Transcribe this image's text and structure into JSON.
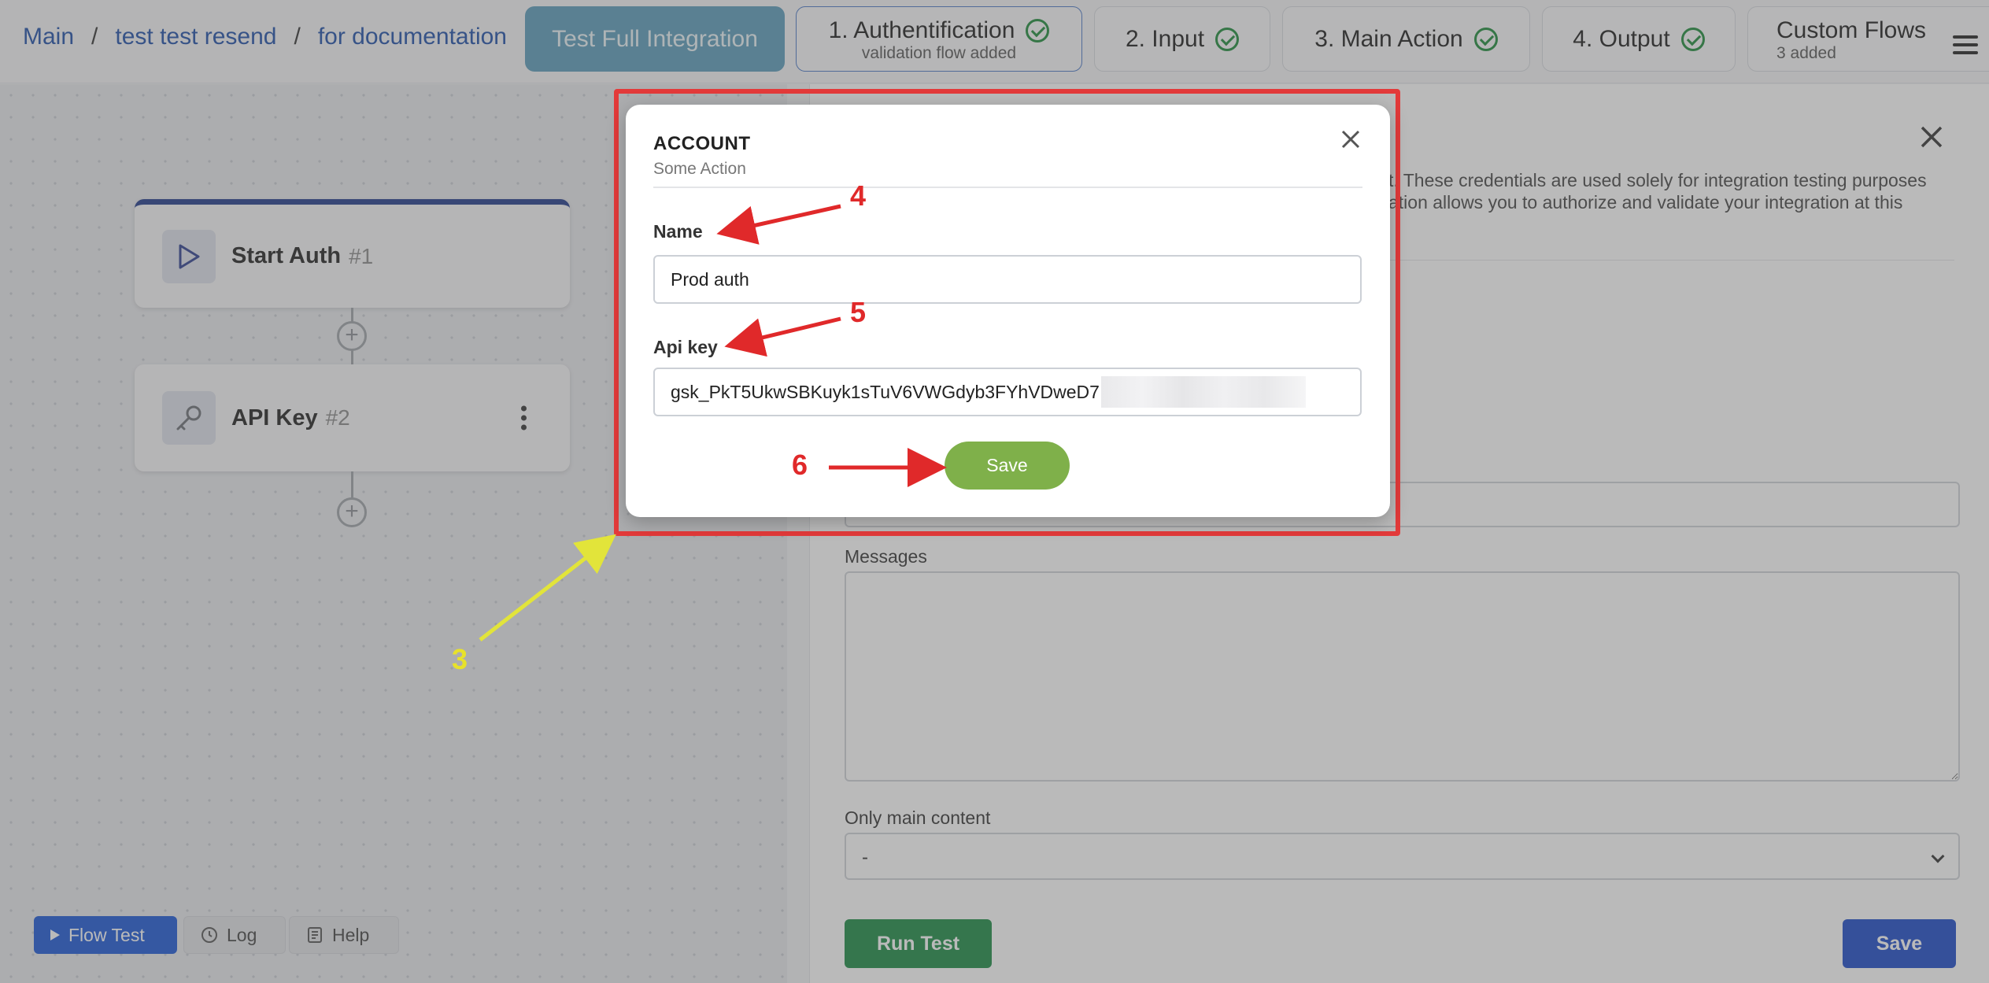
{
  "breadcrumb": {
    "items": [
      "Main",
      "test test resend",
      "for documentation"
    ],
    "separator": "/"
  },
  "tabs": {
    "primary": "Test Full Integration",
    "steps": [
      {
        "label": "1. Authentification",
        "sub": "validation flow added",
        "done": true
      },
      {
        "label": "2. Input",
        "sub": "",
        "done": true
      },
      {
        "label": "3. Main Action",
        "sub": "",
        "done": true
      },
      {
        "label": "4. Output",
        "sub": "",
        "done": true
      }
    ],
    "custom": {
      "label": "Custom Flows",
      "sub": "3 added"
    }
  },
  "canvas": {
    "nodes": [
      {
        "title": "Start Auth",
        "num": "#1",
        "icon": "play-icon"
      },
      {
        "title": "API Key",
        "num": "#2",
        "icon": "key-icon"
      }
    ],
    "buttons": {
      "flow_test": "Flow Test",
      "log": "Log",
      "help": "Help"
    }
  },
  "panel": {
    "description_line1": "t. These credentials are used solely for integration testing purposes",
    "description_line2": "ation allows you to authorize and validate your integration at this",
    "messages_label": "Messages",
    "only_main_label": "Only main content",
    "only_main_value": "-",
    "run_test": "Run Test",
    "save": "Save"
  },
  "modal": {
    "title": "ACCOUNT",
    "subtitle": "Some Action",
    "name_label": "Name",
    "name_value": "Prod auth",
    "apikey_label": "Api key",
    "apikey_value": "gsk_PkT5UkwSBKuyk1sTuV6VWGdyb3FYhVDweD7",
    "save": "Save"
  },
  "annotations": {
    "n3": "3",
    "n4": "4",
    "n5": "5",
    "n6": "6"
  },
  "colors": {
    "accent_blue": "#1a56d6",
    "primary_tab": "#5a9cba",
    "check_green": "#1d8a3a",
    "modal_save": "#7fb04a",
    "run_test": "#1b8a44",
    "annotation_red": "#e0292a",
    "annotation_yellow": "#e8e22a"
  }
}
